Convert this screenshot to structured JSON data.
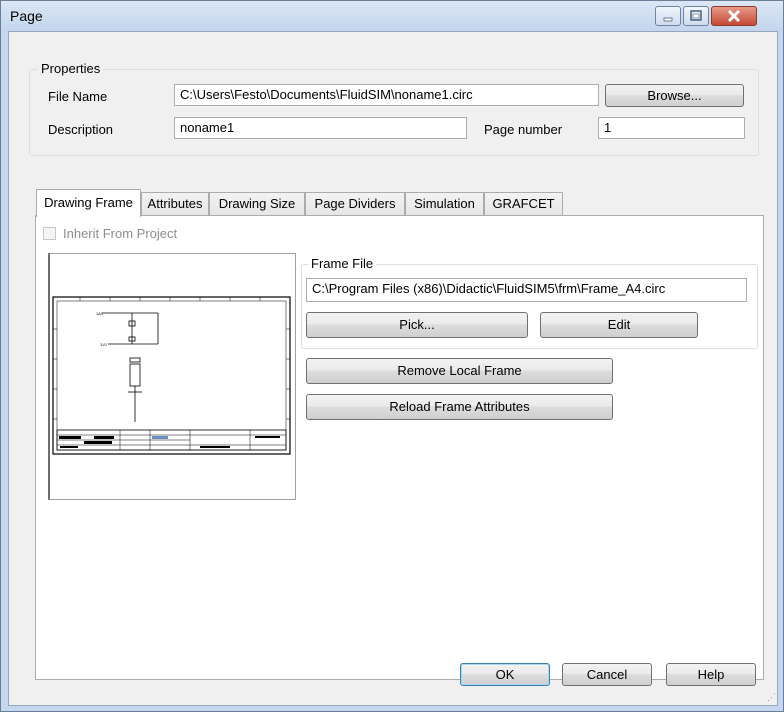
{
  "window": {
    "title": "Page"
  },
  "properties": {
    "group_title": "Properties",
    "file_name_label": "File Name",
    "file_name_value": "C:\\Users\\Festo\\Documents\\FluidSIM\\noname1.circ",
    "browse_label": "Browse...",
    "description_label": "Description",
    "description_value": "noname1",
    "page_number_label": "Page number",
    "page_number_value": "1"
  },
  "tabs": [
    "Drawing Frame",
    "Attributes",
    "Drawing Size",
    "Page Dividers",
    "Simulation",
    "GRAFCET"
  ],
  "drawing_frame": {
    "inherit_label": "Inherit From Project",
    "frame_file_title": "Frame File",
    "frame_file_value": "C:\\Program Files (x86)\\Didactic\\FluidSIM5\\frm\\Frame_A4.circ",
    "pick_label": "Pick...",
    "edit_label": "Edit",
    "remove_label": "Remove Local Frame",
    "reload_label": "Reload Frame Attributes"
  },
  "footer": {
    "ok_label": "OK",
    "cancel_label": "Cancel",
    "help_label": "Help"
  },
  "colors": {
    "title_bar": "#c3d5ec",
    "close_button": "#c44a34",
    "dialog_bg": "#f0f0f0"
  }
}
